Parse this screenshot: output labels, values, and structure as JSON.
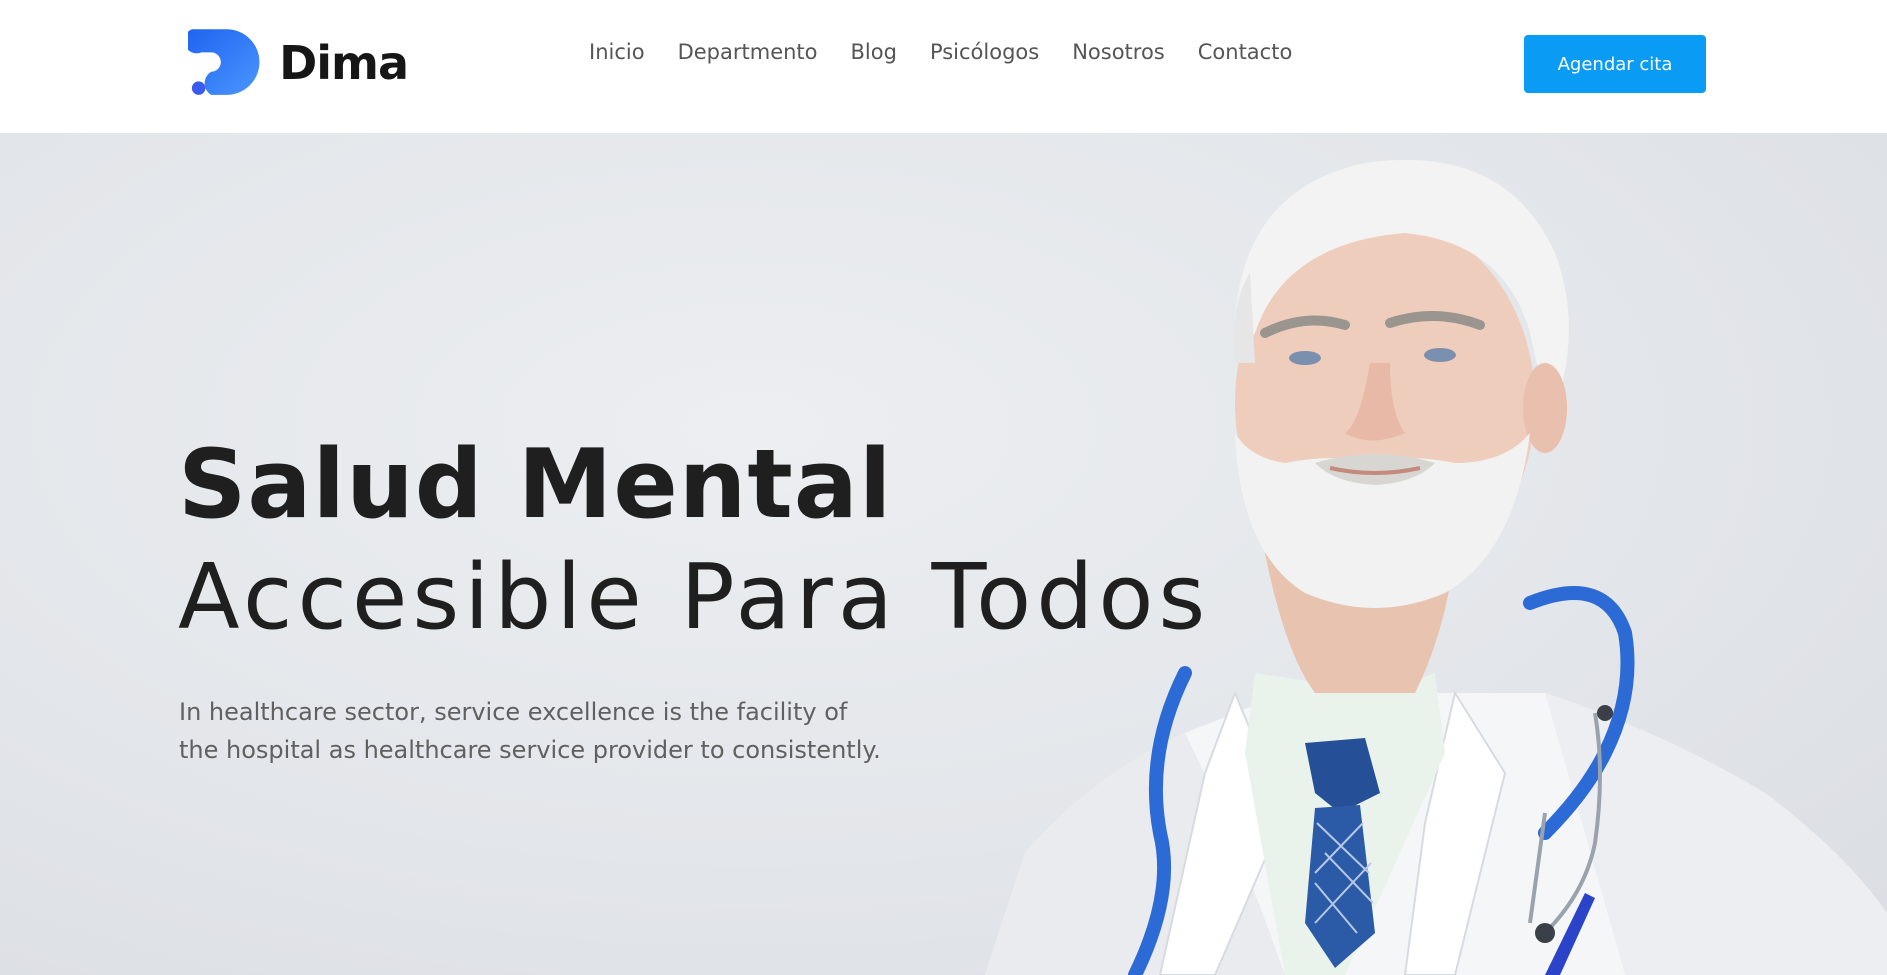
{
  "brand": {
    "name": "Dima",
    "accent_color": "#0a9bf5",
    "logo_colors": [
      "#1e6ef5",
      "#3d8bff"
    ]
  },
  "nav": {
    "items": [
      {
        "label": "Inicio"
      },
      {
        "label": "Departmento"
      },
      {
        "label": "Blog"
      },
      {
        "label": "Psicólogos"
      },
      {
        "label": "Nosotros"
      },
      {
        "label": "Contacto"
      }
    ]
  },
  "header": {
    "cta_label": "Agendar cita"
  },
  "hero": {
    "title_bold": "Salud Mental",
    "title_light": "Accesible Para Todos",
    "description_line1": "In healthcare sector, service excellence is the facility of",
    "description_line2": "the hospital as healthcare service provider to consistently.",
    "image": "doctor-photo"
  }
}
